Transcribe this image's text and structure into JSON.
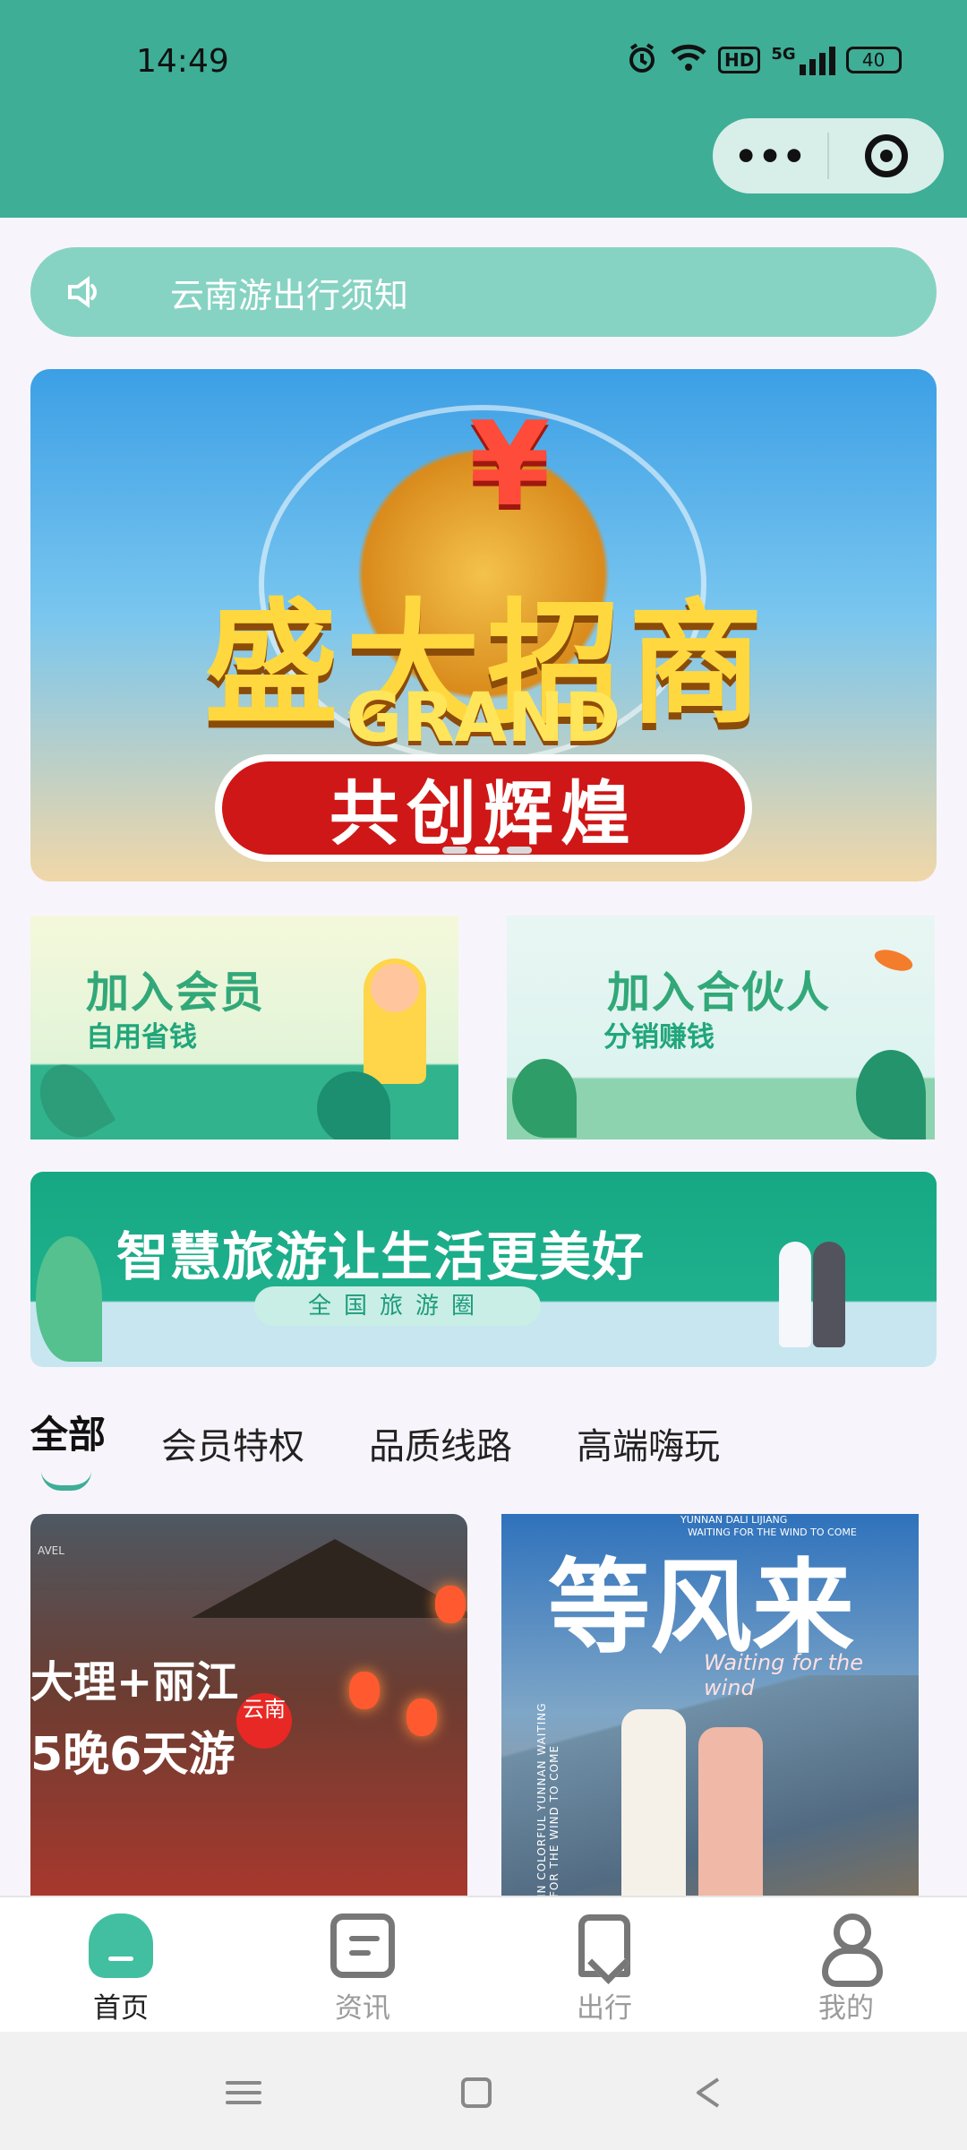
{
  "status_bar": {
    "time": "14:49",
    "battery": "40",
    "network_label": "5G",
    "hd_label": "HD",
    "icons": [
      "alarm-icon",
      "wifi-icon",
      "hd-icon",
      "signal-icon",
      "battery-icon"
    ]
  },
  "mini_program_capsule": {
    "more_label": "•••",
    "icons": [
      "more-icon",
      "target-icon"
    ]
  },
  "notice": {
    "icon": "speaker-icon",
    "text": "云南游出行须知"
  },
  "banner": {
    "title": "盛大招商",
    "subtitle": "GRAND INVESTMENT",
    "slogan": "共创辉煌",
    "page_count": 3,
    "active_page": 2
  },
  "promos": [
    {
      "title": "加入会员",
      "subtitle": "自用省钱"
    },
    {
      "title": "加入合伙人",
      "subtitle": "分销赚钱"
    }
  ],
  "wide_banner": {
    "title": "智慧旅游让生活更美好",
    "chip": "全国旅游圈"
  },
  "tabs": {
    "items": [
      "全部",
      "会员特权",
      "品质线路",
      "高端嗨玩"
    ],
    "active": "全部"
  },
  "cards": [
    {
      "line1": "大理+丽江",
      "line2": "5晚6天游",
      "seal": "云南",
      "small_label": "AVEL"
    },
    {
      "title": "等风来",
      "script": "Waiting for the wind",
      "small_label": "YUNNAN DALI LIJIANG",
      "small_label_2": "WAITING FOR THE WIND TO COME",
      "vertical_text": "IN COLORFUL YUNNAN WAITING FOR THE WIND TO COME"
    }
  ],
  "bottom_nav": {
    "items": [
      {
        "label": "首页",
        "icon": "home-icon",
        "active": true
      },
      {
        "label": "资讯",
        "icon": "news-icon",
        "active": false
      },
      {
        "label": "出行",
        "icon": "bookmark-icon",
        "active": false
      },
      {
        "label": "我的",
        "icon": "user-icon",
        "active": false
      }
    ]
  },
  "system_nav": {
    "icons": [
      "menu-icon",
      "home-square-icon",
      "back-icon"
    ]
  },
  "colors": {
    "primary": "#3eae96",
    "notice_bg": "#87d3c3",
    "active_nav": "#42bfa1"
  }
}
